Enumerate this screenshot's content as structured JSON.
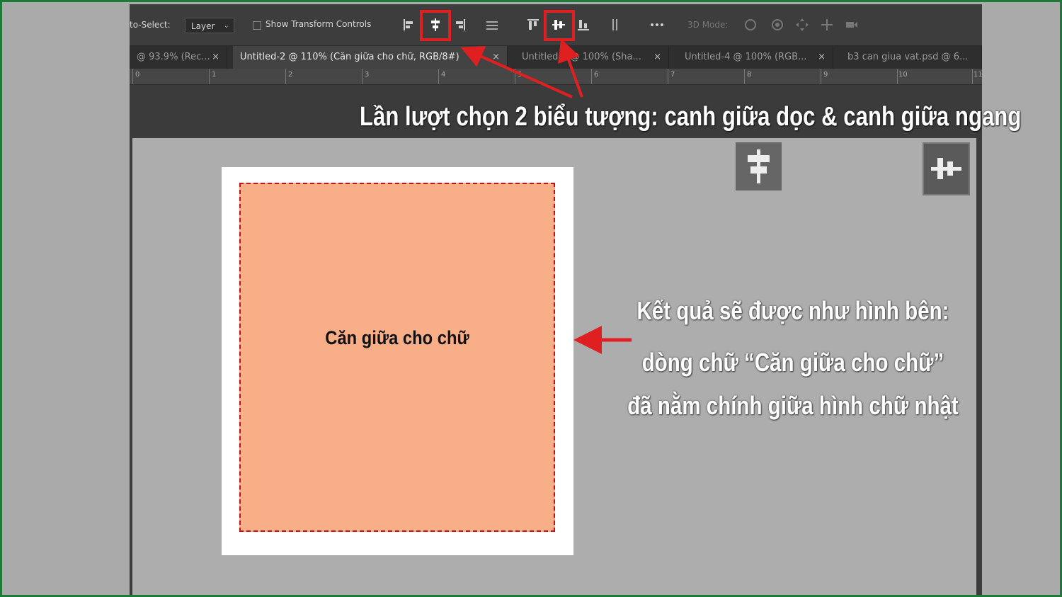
{
  "options_bar": {
    "auto_select_label": "to-Select:",
    "auto_select_value": "Layer",
    "show_transform_label": "Show Transform Controls",
    "mode_3d_label": "3D Mode:"
  },
  "tabs": [
    {
      "label": "@ 93.9% (Rec...",
      "active": false
    },
    {
      "label": "Untitled-2 @ 110% (Căn giữa cho chữ, RGB/8#)",
      "active": true
    },
    {
      "label": "Untitled-3 @ 100% (Sha...",
      "active": false
    },
    {
      "label": "Untitled-4 @ 100% (RGB...",
      "active": false
    },
    {
      "label": "b3 can giua vat.psd @ 6...",
      "active": false
    }
  ],
  "ruler": {
    "ticks": [
      "0",
      "1",
      "2",
      "3",
      "4",
      "5",
      "6",
      "7",
      "8",
      "9",
      "10",
      "11"
    ]
  },
  "canvas": {
    "rect_text": "Căn giữa cho chữ",
    "rect_fill": "#f8ae86",
    "selection_color": "#c4101a"
  },
  "annotations": {
    "top_caption": "Lần lượt chọn 2 biểu tượng: canh giữa dọc & canh giữa ngang",
    "result_line1": "Kết quả sẽ được như hình bên:",
    "result_line2": "dòng chữ “Căn giữa cho chữ”",
    "result_line3": "đã nằm chính giữa hình chữ nhật",
    "highlight_color": "#e02020"
  },
  "icons": {
    "align_left": "align-left-edges-icon",
    "align_vcenter": "align-vertical-centers-icon",
    "align_right": "align-right-edges-icon",
    "align_top": "align-top-edges-icon",
    "align_hcenter": "align-horizontal-centers-icon",
    "align_bottom": "align-bottom-edges-icon"
  }
}
